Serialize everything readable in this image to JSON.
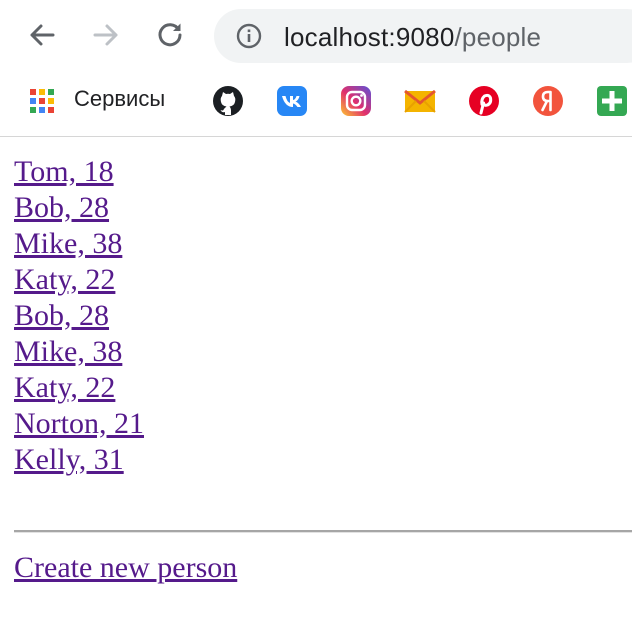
{
  "browser": {
    "url_host": "localhost:9080",
    "url_path": "/people",
    "back_icon": "arrow-left-icon",
    "forward_icon": "arrow-right-icon",
    "reload_icon": "reload-icon",
    "info_icon": "info-circle-icon"
  },
  "bookmarks_bar": {
    "apps_label": "Сервисы",
    "items": [
      {
        "icon": "github-icon",
        "color": "#1b1f23"
      },
      {
        "icon": "vk-icon",
        "color": "#2787f5"
      },
      {
        "icon": "instagram-icon",
        "color": "#c13584"
      },
      {
        "icon": "gmail-icon",
        "color": "#f4b400"
      },
      {
        "icon": "pinterest-icon",
        "color": "#e60023"
      },
      {
        "icon": "yandex-icon",
        "color": "#f2543d"
      },
      {
        "icon": "google-keep-plus-icon",
        "color": "#34a853"
      }
    ]
  },
  "people": [
    {
      "label": "Tom, 18"
    },
    {
      "label": "Bob, 28"
    },
    {
      "label": "Mike, 38"
    },
    {
      "label": "Katy, 22"
    },
    {
      "label": "Bob, 28"
    },
    {
      "label": "Mike, 38"
    },
    {
      "label": "Katy, 22"
    },
    {
      "label": "Norton, 21"
    },
    {
      "label": "Kelly, 31"
    }
  ],
  "create_link_label": "Create new person",
  "colors": {
    "link_visited": "#551a8b",
    "omnibox_bg": "#f1f3f4"
  }
}
